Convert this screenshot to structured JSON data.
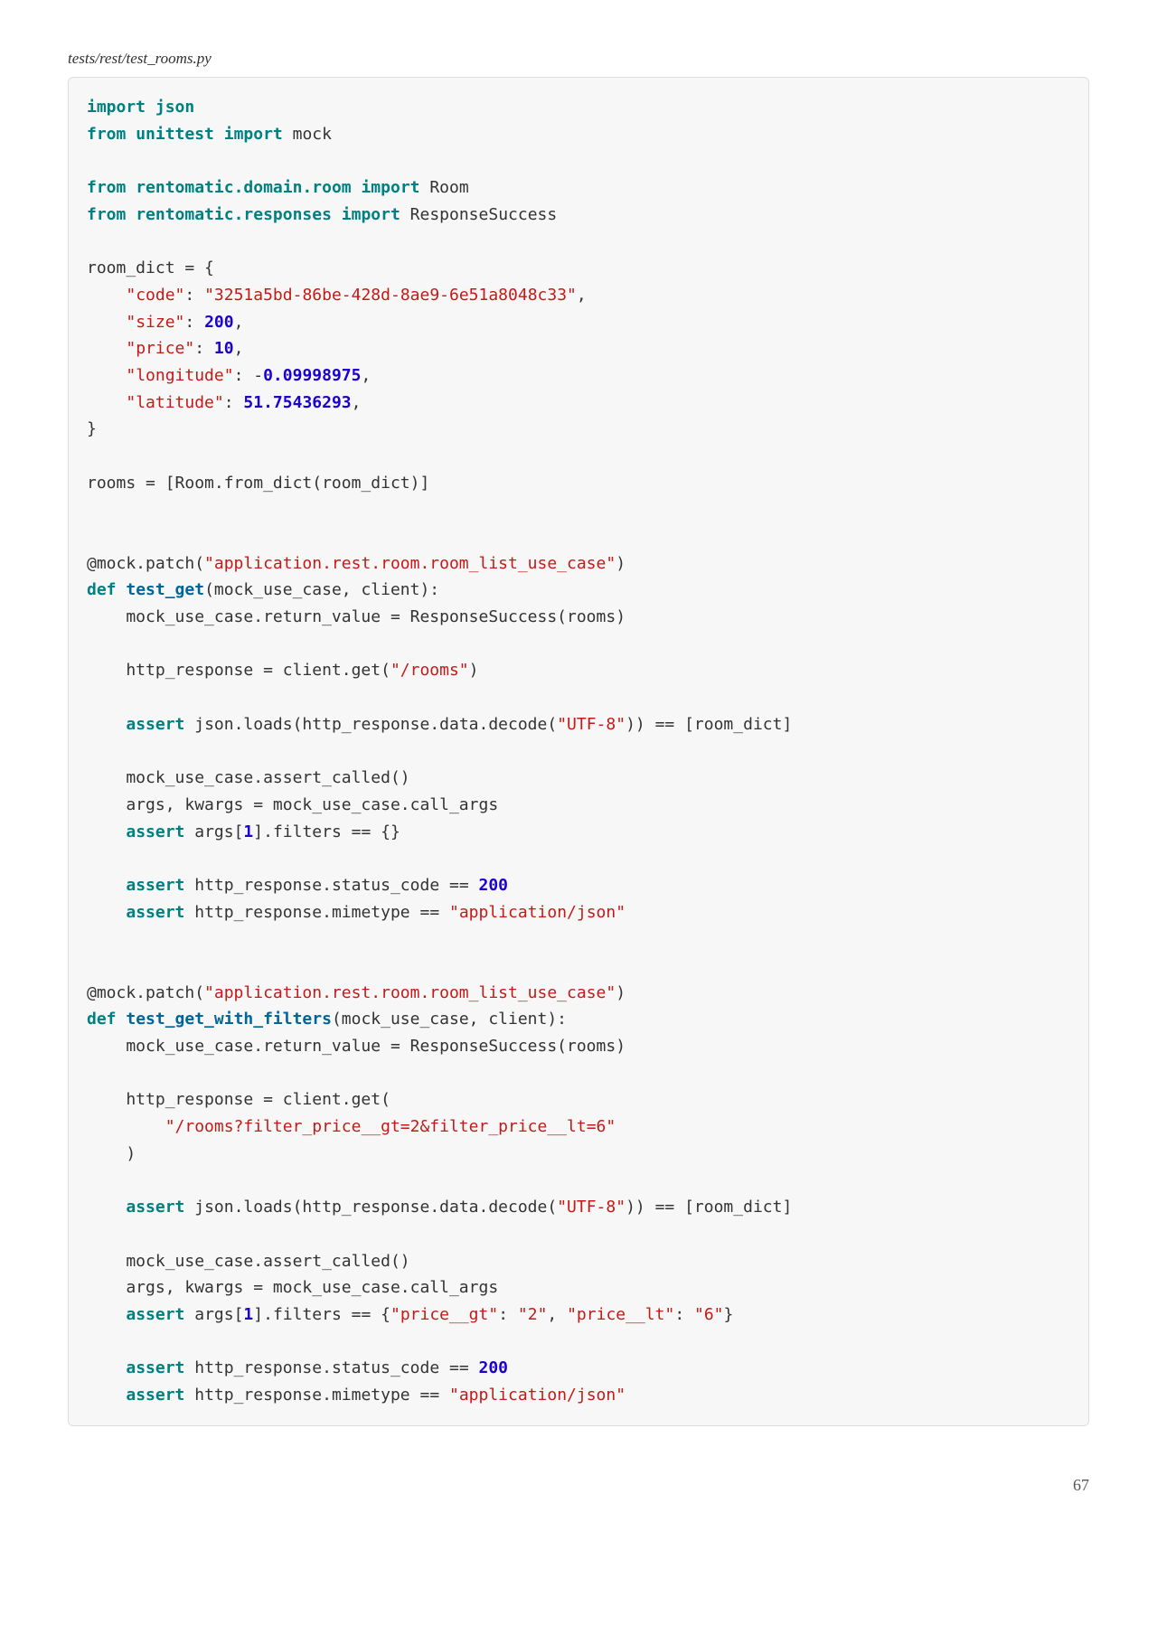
{
  "file_path": "tests/rest/test_rooms.py",
  "page_number": "67",
  "code": {
    "l1_import": "import",
    "l1_json": "json",
    "l2_from": "from",
    "l2_unittest": "unittest",
    "l2_import": "import",
    "l2_mock": " mock",
    "l4_from": "from",
    "l4_mod": "rentomatic.domain.room",
    "l4_import": "import",
    "l4_room": " Room",
    "l5_from": "from",
    "l5_mod": "rentomatic.responses",
    "l5_import": "import",
    "l5_rs": " ResponseSuccess",
    "l7_a": "room_dict = {",
    "l8_key": "\"code\"",
    "l8_c": ": ",
    "l8_val": "\"3251a5bd-86be-428d-8ae9-6e51a8048c33\"",
    "l8_comma": ",",
    "l9_key": "\"size\"",
    "l9_c": ": ",
    "l9_val": "200",
    "l9_comma": ",",
    "l10_key": "\"price\"",
    "l10_c": ": ",
    "l10_val": "10",
    "l10_comma": ",",
    "l11_key": "\"longitude\"",
    "l11_c": ": -",
    "l11_val": "0.09998975",
    "l11_comma": ",",
    "l12_key": "\"latitude\"",
    "l12_c": ": ",
    "l12_val": "51.75436293",
    "l12_comma": ",",
    "l13": "}",
    "l15": "rooms = [Room.from_dict(room_dict)]",
    "l18_at": "@mock.patch(",
    "l18_str": "\"application.rest.room.room_list_use_case\"",
    "l18_close": ")",
    "l19_def": "def",
    "l19_name": "test_get",
    "l19_args": "(mock_use_case, client):",
    "l20": "    mock_use_case.return_value = ResponseSuccess(rooms)",
    "l22_a": "    http_response = client.get(",
    "l22_str": "\"/rooms\"",
    "l22_b": ")",
    "l24_assert": "assert",
    "l24_a": " json.loads(http_response.data.decode(",
    "l24_str": "\"UTF-8\"",
    "l24_b": ")) == [room_dict]",
    "l26": "    mock_use_case.assert_called()",
    "l27": "    args, kwargs = mock_use_case.call_args",
    "l28_assert": "assert",
    "l28_a": " args[",
    "l28_num": "1",
    "l28_b": "].filters == {}",
    "l30_assert": "assert",
    "l30_a": " http_response.status_code == ",
    "l30_num": "200",
    "l31_assert": "assert",
    "l31_a": " http_response.mimetype == ",
    "l31_str": "\"application/json\"",
    "l34_at": "@mock.patch(",
    "l34_str": "\"application.rest.room.room_list_use_case\"",
    "l34_close": ")",
    "l35_def": "def",
    "l35_name": "test_get_with_filters",
    "l35_args": "(mock_use_case, client):",
    "l36": "    mock_use_case.return_value = ResponseSuccess(rooms)",
    "l38": "    http_response = client.get(",
    "l39_str": "\"/rooms?filter_price__gt=2&filter_price__lt=6\"",
    "l40": "    )",
    "l42_assert": "assert",
    "l42_a": " json.loads(http_response.data.decode(",
    "l42_str": "\"UTF-8\"",
    "l42_b": ")) == [room_dict]",
    "l44": "    mock_use_case.assert_called()",
    "l45": "    args, kwargs = mock_use_case.call_args",
    "l46_assert": "assert",
    "l46_a": " args[",
    "l46_num": "1",
    "l46_b": "].filters == {",
    "l46_k1": "\"price__gt\"",
    "l46_c1": ": ",
    "l46_v1": "\"2\"",
    "l46_c2": ", ",
    "l46_k2": "\"price__lt\"",
    "l46_c3": ": ",
    "l46_v2": "\"6\"",
    "l46_close": "}",
    "l48_assert": "assert",
    "l48_a": " http_response.status_code == ",
    "l48_num": "200",
    "l49_assert": "assert",
    "l49_a": " http_response.mimetype == ",
    "l49_str": "\"application/json\""
  }
}
